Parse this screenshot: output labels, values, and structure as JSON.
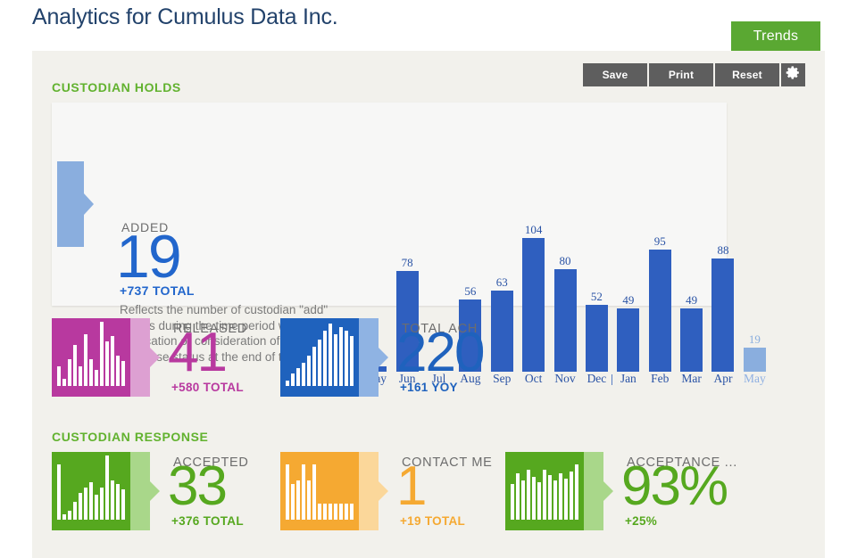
{
  "header": {
    "title": "Analytics for Cumulus Data Inc.",
    "title_color": "#22426b"
  },
  "trends_tab": {
    "label": "Trends",
    "color": "#5aa832"
  },
  "toolbar": {
    "save_label": "Save",
    "print_label": "Print",
    "reset_label": "Reset",
    "settings_icon": "gear-icon"
  },
  "sections": {
    "custodian_holds": "CUSTODIAN HOLDS",
    "custodian_response": "CUSTODIAN RESPONSE",
    "heading_color": "#62b22f"
  },
  "added_card": {
    "label": "ADDED",
    "value": "19",
    "total": "+737 TOTAL",
    "description": "Reflects the number of custodian \"add\" events during the time period without de-duplication or consideration of the response status at the end of the period.",
    "color": "#2266cc"
  },
  "chart_data": {
    "type": "bar",
    "title": "ADDED",
    "xlabel": "",
    "ylabel": "",
    "ylim": [
      0,
      104
    ],
    "grid": false,
    "legend": false,
    "categories": [
      "May",
      "Jun",
      "Jul",
      "Aug",
      "Sep",
      "Oct",
      "Nov",
      "Dec",
      "Jan",
      "Feb",
      "Mar",
      "Apr",
      "May"
    ],
    "values": [
      4,
      78,
      0,
      56,
      63,
      104,
      80,
      52,
      49,
      95,
      49,
      88,
      19
    ],
    "labels": [
      "4",
      "78",
      "",
      "56",
      "63",
      "104",
      "80",
      "52",
      "49",
      "95",
      "49",
      "88",
      "19"
    ],
    "bar_color": "#2f5fbf",
    "highlight_color": "#8aaede",
    "highlight_index": 12,
    "year_separator_before": 8,
    "note": "Last May bar is rendered in a lighter shade indicating a partial / current period."
  },
  "kpis": [
    {
      "id": "released",
      "title": "RELEASED",
      "value": "41",
      "sub": "+580 TOTAL",
      "color": "#b8399f",
      "icon": "bar-chart-icon",
      "spark": [
        22,
        8,
        30,
        46,
        22,
        58,
        30,
        18,
        72,
        50,
        56,
        34,
        28
      ]
    },
    {
      "id": "total-ach",
      "title": "TOTAL ACH",
      "value": "220",
      "sub": "+161 YOY",
      "color": "#1f62bd",
      "icon": "bar-chart-icon",
      "spark": [
        6,
        14,
        20,
        26,
        34,
        44,
        52,
        62,
        70,
        58,
        66,
        62,
        56
      ]
    },
    {
      "id": "accepted",
      "title": "ACCEPTED",
      "value": "33",
      "sub": "+376 TOTAL",
      "color": "#56a81f",
      "icon": "bar-chart-icon",
      "spark": [
        62,
        6,
        10,
        20,
        30,
        36,
        42,
        28,
        36,
        72,
        44,
        40,
        34
      ]
    },
    {
      "id": "contact-me",
      "title": "CONTACT ME",
      "value": "1",
      "sub": "+19 TOTAL",
      "color": "#f5a932",
      "icon": "bar-chart-icon",
      "spark": [
        62,
        40,
        44,
        62,
        44,
        62,
        18,
        18,
        18,
        18,
        18,
        18,
        18
      ]
    },
    {
      "id": "acceptance-rate",
      "title": "ACCEPTANCE ...",
      "value": "93%",
      "sub": "+25%",
      "color": "#56a81f",
      "icon": "bar-chart-icon",
      "spark": [
        40,
        52,
        44,
        56,
        48,
        42,
        56,
        50,
        44,
        52,
        46,
        54,
        62
      ]
    }
  ]
}
